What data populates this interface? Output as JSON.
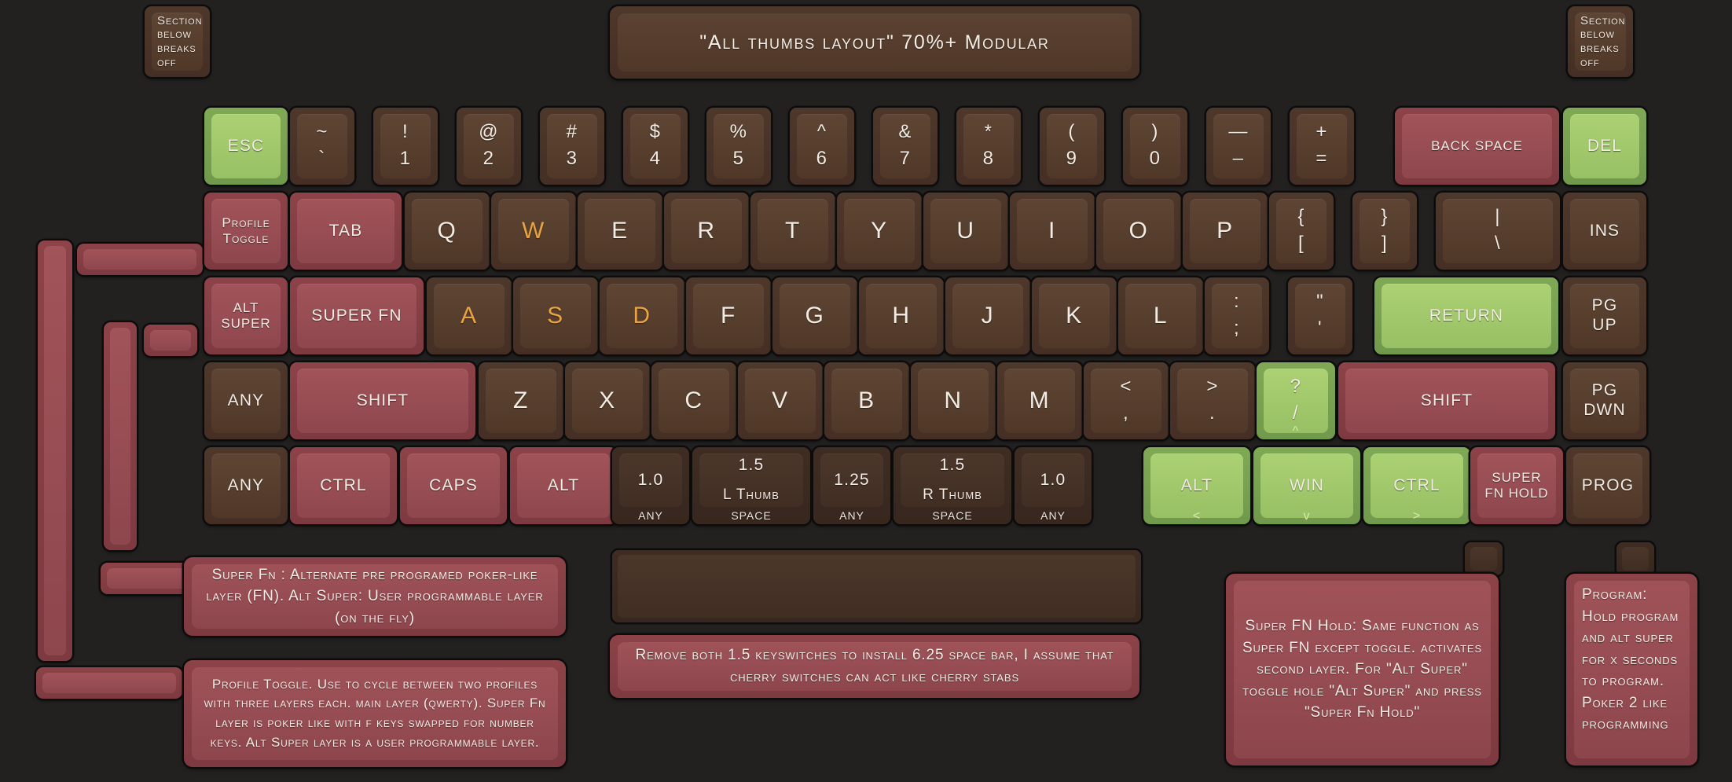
{
  "title_panel": {
    "text": "\"All thumbs layout\" 70%+ Modular"
  },
  "corner_notes": {
    "left": {
      "text": "Section\nbelow\nbreaks\noff"
    },
    "right": {
      "text": "Section\nbelow\nbreaks\noff"
    }
  },
  "colors": {
    "background": "#222120",
    "key_brown": "#4e382b",
    "key_brown_top": "#5e4534",
    "key_red": "#8d4348",
    "key_red_top": "#a1545a",
    "key_green": "#7fa955",
    "key_green_top": "#abd173",
    "key_dark": "#3f2d23",
    "legend_white": "#f2ece4",
    "legend_orange": "#e9a441",
    "arrow_label": "#d9e9ae"
  },
  "rows": {
    "number_row": [
      {
        "label": "ESC",
        "color": "green",
        "size": "md"
      },
      {
        "top": "~",
        "bottom": "`",
        "color": "brown",
        "dual": true
      },
      {
        "top": "!",
        "bottom": "1",
        "color": "brown",
        "dual": true
      },
      {
        "top": "@",
        "bottom": "2",
        "color": "brown",
        "dual": true
      },
      {
        "top": "#",
        "bottom": "3",
        "color": "brown",
        "dual": true
      },
      {
        "top": "$",
        "bottom": "4",
        "color": "brown",
        "dual": true
      },
      {
        "top": "%",
        "bottom": "5",
        "color": "brown",
        "dual": true
      },
      {
        "top": "^",
        "bottom": "6",
        "color": "brown",
        "dual": true
      },
      {
        "top": "&",
        "bottom": "7",
        "color": "brown",
        "dual": true
      },
      {
        "top": "*",
        "bottom": "8",
        "color": "brown",
        "dual": true
      },
      {
        "top": "(",
        "bottom": "9",
        "color": "brown",
        "dual": true
      },
      {
        "top": ")",
        "bottom": "0",
        "color": "brown",
        "dual": true
      },
      {
        "top": "—",
        "bottom": "–",
        "color": "brown",
        "dual": true
      },
      {
        "top": "+",
        "bottom": "=",
        "color": "brown",
        "dual": true
      },
      {
        "label": "BACK SPACE",
        "color": "red",
        "size": "sm"
      },
      {
        "label": "DEL",
        "color": "green",
        "size": "md"
      }
    ],
    "qwerty_row": [
      {
        "label": "Profile\nToggle",
        "color": "red",
        "size": "sm"
      },
      {
        "label": "TAB",
        "color": "red",
        "size": "md"
      },
      {
        "label": "Q",
        "color": "brown",
        "size": "xl"
      },
      {
        "label": "W",
        "color": "brown",
        "size": "xl",
        "orange": true
      },
      {
        "label": "E",
        "color": "brown",
        "size": "xl"
      },
      {
        "label": "R",
        "color": "brown",
        "size": "xl"
      },
      {
        "label": "T",
        "color": "brown",
        "size": "xl"
      },
      {
        "label": "Y",
        "color": "brown",
        "size": "xl"
      },
      {
        "label": "U",
        "color": "brown",
        "size": "xl"
      },
      {
        "label": "I",
        "color": "brown",
        "size": "xl"
      },
      {
        "label": "O",
        "color": "brown",
        "size": "xl"
      },
      {
        "label": "P",
        "color": "brown",
        "size": "xl"
      },
      {
        "top": "{",
        "bottom": "[",
        "color": "brown",
        "dual": true
      },
      {
        "top": "}",
        "bottom": "]",
        "color": "brown",
        "dual": true
      },
      {
        "top": "|",
        "bottom": "\\",
        "color": "brown",
        "dual": true
      },
      {
        "label": "INS",
        "color": "brown",
        "size": "md"
      }
    ],
    "home_row": [
      {
        "label": "ALT\nSUPER",
        "color": "red",
        "size": "sm"
      },
      {
        "label": "SUPER FN",
        "color": "red",
        "size": "md"
      },
      {
        "label": "A",
        "color": "brown",
        "size": "xl",
        "orange": true
      },
      {
        "label": "S",
        "color": "brown",
        "size": "xl",
        "orange": true
      },
      {
        "label": "D",
        "color": "brown",
        "size": "xl",
        "orange": true
      },
      {
        "label": "F",
        "color": "brown",
        "size": "xl"
      },
      {
        "label": "G",
        "color": "brown",
        "size": "xl"
      },
      {
        "label": "H",
        "color": "brown",
        "size": "xl"
      },
      {
        "label": "J",
        "color": "brown",
        "size": "xl"
      },
      {
        "label": "K",
        "color": "brown",
        "size": "xl"
      },
      {
        "label": "L",
        "color": "brown",
        "size": "xl"
      },
      {
        "top": ":",
        "bottom": ";",
        "color": "brown",
        "dual": true
      },
      {
        "top": "\"",
        "bottom": "'",
        "color": "brown",
        "dual": true
      },
      {
        "label": "RETURN",
        "color": "green",
        "size": "md"
      },
      {
        "label": "PG\nUP",
        "color": "brown",
        "size": "md"
      }
    ],
    "shift_row": [
      {
        "label": "ANY",
        "color": "brown",
        "size": "md"
      },
      {
        "label": "SHIFT",
        "color": "red",
        "size": "md"
      },
      {
        "label": "Z",
        "color": "brown",
        "size": "xl"
      },
      {
        "label": "X",
        "color": "brown",
        "size": "xl"
      },
      {
        "label": "C",
        "color": "brown",
        "size": "xl"
      },
      {
        "label": "V",
        "color": "brown",
        "size": "xl"
      },
      {
        "label": "B",
        "color": "brown",
        "size": "xl"
      },
      {
        "label": "N",
        "color": "brown",
        "size": "xl"
      },
      {
        "label": "M",
        "color": "brown",
        "size": "xl"
      },
      {
        "top": "<",
        "bottom": ",",
        "color": "brown",
        "dual": true
      },
      {
        "top": ">",
        "bottom": ".",
        "color": "brown",
        "dual": true
      },
      {
        "top": "?",
        "bottom": "/",
        "color": "green",
        "dual": true,
        "arrow": "^"
      },
      {
        "label": "SHIFT",
        "color": "red",
        "size": "md"
      },
      {
        "label": "PG\nDWN",
        "color": "brown",
        "size": "md"
      }
    ],
    "bottom_row": [
      {
        "label": "ANY",
        "color": "brown",
        "size": "md"
      },
      {
        "label": "CTRL",
        "color": "red",
        "size": "md"
      },
      {
        "label": "CAPS",
        "color": "red",
        "size": "md"
      },
      {
        "label": "ALT",
        "color": "red",
        "size": "md"
      },
      {
        "label": "1.0",
        "sublabel": "ANY",
        "color": "dark",
        "size": "md"
      },
      {
        "label": "1.5",
        "sub_top": "L Thumb",
        "sublabel": "SPACE",
        "color": "dark",
        "size": "md"
      },
      {
        "label": "1.25",
        "sublabel": "ANY",
        "color": "dark",
        "size": "md"
      },
      {
        "label": "1.5",
        "sub_top": "R Thumb",
        "sublabel": "SPACE",
        "color": "dark",
        "size": "md"
      },
      {
        "label": "1.0",
        "sublabel": "ANY",
        "color": "dark",
        "size": "md"
      },
      {
        "label": "ALT",
        "color": "green",
        "size": "md",
        "arrow": "<"
      },
      {
        "label": "WIN",
        "color": "green",
        "size": "md",
        "arrow": "v"
      },
      {
        "label": "CTRL",
        "color": "green",
        "size": "md",
        "arrow": ">"
      },
      {
        "label": "SUPER\nFN HOLD",
        "color": "red",
        "size": "sm"
      },
      {
        "label": "PROG",
        "color": "brown",
        "size": "md"
      }
    ]
  },
  "notes": {
    "super_fn": {
      "text": "Super Fn : Alternate pre programed poker-like layer (FN). Alt Super: User programmable layer (on the fly)"
    },
    "profile_toggle": {
      "text": "Profile Toggle. Use to cycle between two profiles with three layers each. main layer (qwerty). Super Fn layer is poker like with f keys swapped for number keys. Alt Super layer is a user programmable layer."
    },
    "spacebar": {
      "text": "Remove both 1.5 keyswitches to install 6.25 space bar, I assume that cherry switches can act like cherry stabs"
    },
    "super_fn_hold": {
      "text": "Super FN Hold: Same function as Super FN except toggle. activates second layer. For \"Alt Super\" toggle hole \"Alt Super\" and press \"Super Fn Hold\""
    },
    "program": {
      "text": "Program: Hold program and alt super for x seconds to program. Poker 2 like programming"
    }
  }
}
